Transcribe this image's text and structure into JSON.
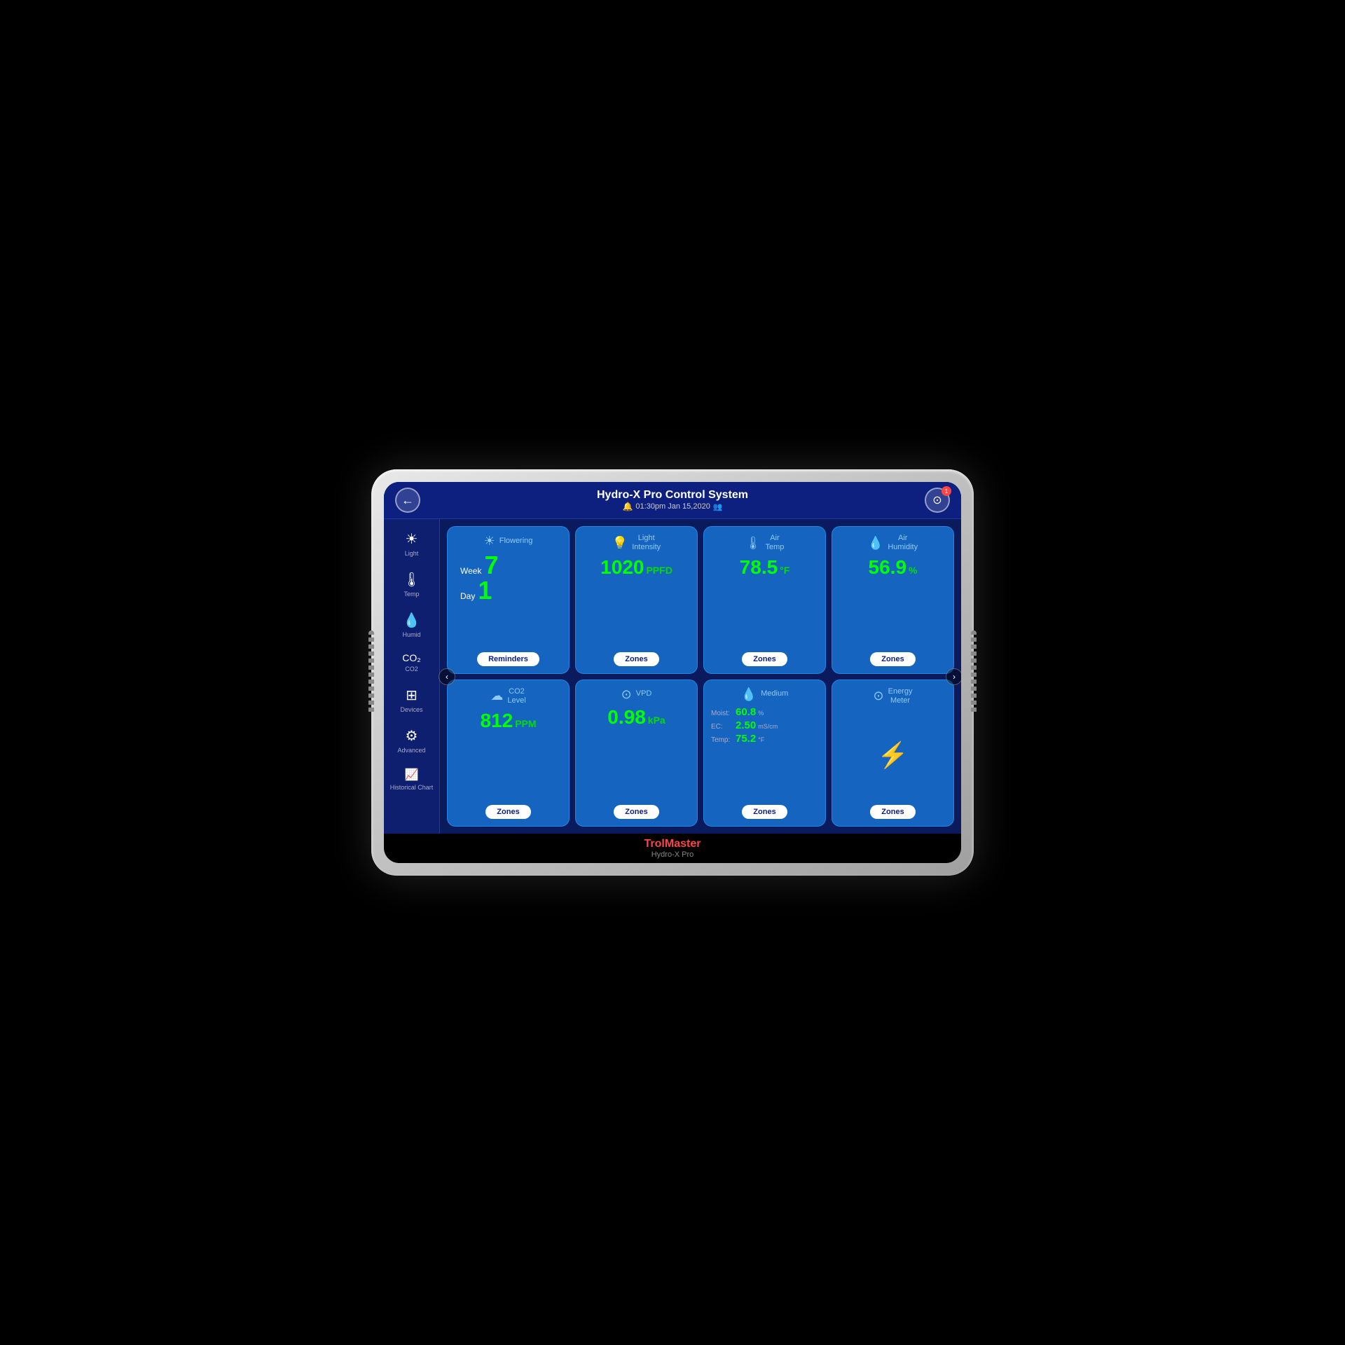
{
  "header": {
    "title": "Hydro-X Pro Control System",
    "datetime": "01:30pm  Jan 15,2020",
    "back_label": "←",
    "settings_label": "⊙",
    "notification_count": "1"
  },
  "sidebar": {
    "items": [
      {
        "id": "light",
        "icon": "☀",
        "label": "Light"
      },
      {
        "id": "temp",
        "icon": "🌡",
        "label": "Temp"
      },
      {
        "id": "humid",
        "icon": "💧",
        "label": "Humid"
      },
      {
        "id": "co2",
        "icon": "⬡",
        "label": "CO2"
      },
      {
        "id": "devices",
        "icon": "⊞",
        "label": "Devices"
      },
      {
        "id": "advanced",
        "icon": "⚙",
        "label": "Advanced"
      },
      {
        "id": "historical",
        "icon": "📈",
        "label": "Historical Chart"
      }
    ]
  },
  "nav": {
    "left": "‹",
    "right": "›"
  },
  "cards_row1": [
    {
      "id": "flowering",
      "icon": "☀",
      "title": "Flowering",
      "week_label": "Week",
      "week_value": "7",
      "day_label": "Day",
      "day_value": "1",
      "btn_label": "Reminders"
    },
    {
      "id": "light-intensity",
      "icon": "💡",
      "title": "Light\nIntensity",
      "value": "1020",
      "unit": "PPFD",
      "btn_label": "Zones"
    },
    {
      "id": "air-temp",
      "icon": "🌡",
      "title": "Air\nTemp",
      "value": "78.5",
      "unit": "°F",
      "btn_label": "Zones"
    },
    {
      "id": "air-humidity",
      "icon": "💧",
      "title": "Air\nHumidity",
      "value": "56.9",
      "unit": "%",
      "btn_label": "Zones"
    }
  ],
  "cards_row2": [
    {
      "id": "co2-level",
      "icon": "☁",
      "title": "CO2\nLevel",
      "value": "812",
      "unit": "PPM",
      "btn_label": "Zones"
    },
    {
      "id": "vpd",
      "icon": "⊙",
      "title": "VPD",
      "value": "0.98",
      "unit": "kPa",
      "btn_label": "Zones"
    },
    {
      "id": "medium",
      "icon": "💧",
      "title": "Medium",
      "moist_label": "Moist:",
      "moist_value": "60.8",
      "moist_unit": "%",
      "ec_label": "EC:",
      "ec_value": "2.50",
      "ec_unit": "mS/cm",
      "temp_label": "Temp:",
      "temp_value": "75.2",
      "temp_unit": "°F",
      "btn_label": "Zones"
    },
    {
      "id": "energy-meter",
      "icon": "⊙",
      "title": "Energy\nMeter",
      "energy_icon": "⚡",
      "btn_label": "Zones"
    }
  ],
  "brand": {
    "name_part1": "Trol",
    "name_accent": "M",
    "name_part2": "aster",
    "subtitle": "Hydro-X Pro"
  }
}
